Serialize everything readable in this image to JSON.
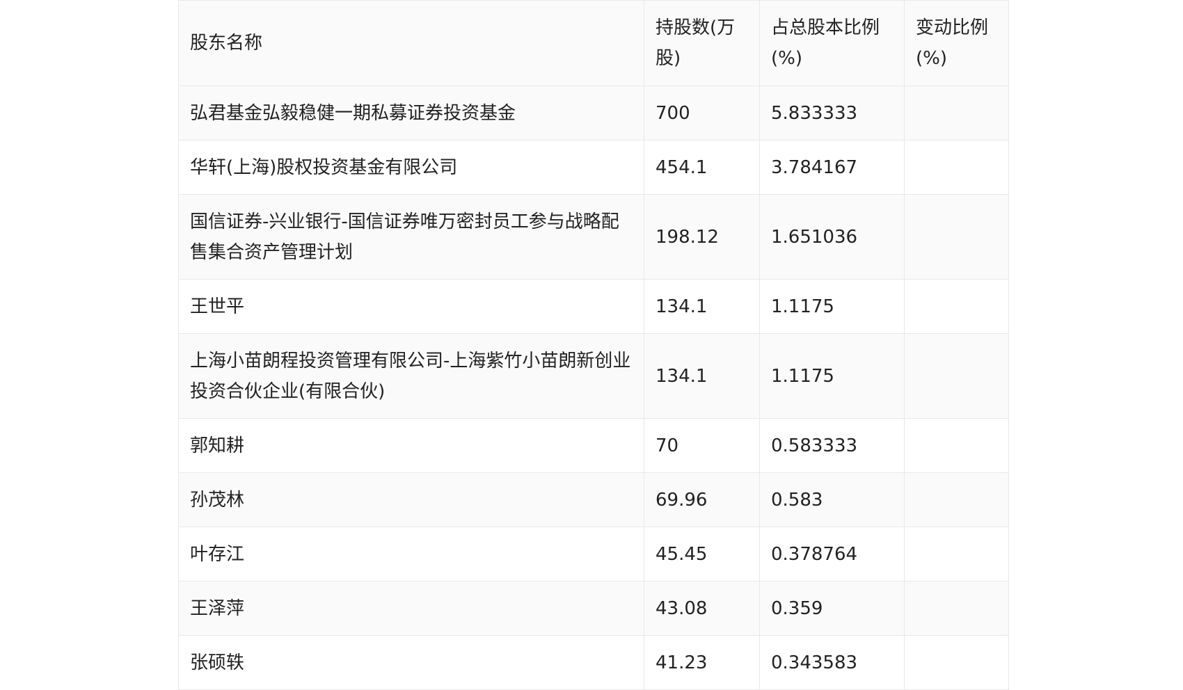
{
  "table": {
    "headers": [
      "股东名称",
      "持股数(万股)",
      "占总股本比例(%)",
      "变动比例(%)"
    ],
    "rows": [
      {
        "name": "弘君基金弘毅稳健一期私募证券投资基金",
        "shares": "700",
        "ratio": "5.833333",
        "change": ""
      },
      {
        "name": "华轩(上海)股权投资基金有限公司",
        "shares": "454.1",
        "ratio": "3.784167",
        "change": ""
      },
      {
        "name": "国信证券-兴业银行-国信证券唯万密封员工参与战略配售集合资产管理计划",
        "shares": "198.12",
        "ratio": "1.651036",
        "change": ""
      },
      {
        "name": "王世平",
        "shares": "134.1",
        "ratio": "1.1175",
        "change": ""
      },
      {
        "name": "上海小苗朗程投资管理有限公司-上海紫竹小苗朗新创业投资合伙企业(有限合伙)",
        "shares": "134.1",
        "ratio": "1.1175",
        "change": ""
      },
      {
        "name": "郭知耕",
        "shares": "70",
        "ratio": "0.583333",
        "change": ""
      },
      {
        "name": "孙茂林",
        "shares": "69.96",
        "ratio": "0.583",
        "change": ""
      },
      {
        "name": "叶存江",
        "shares": "45.45",
        "ratio": "0.378764",
        "change": ""
      },
      {
        "name": "王泽萍",
        "shares": "43.08",
        "ratio": "0.359",
        "change": ""
      },
      {
        "name": "张硕轶",
        "shares": "41.23",
        "ratio": "0.343583",
        "change": ""
      }
    ]
  }
}
